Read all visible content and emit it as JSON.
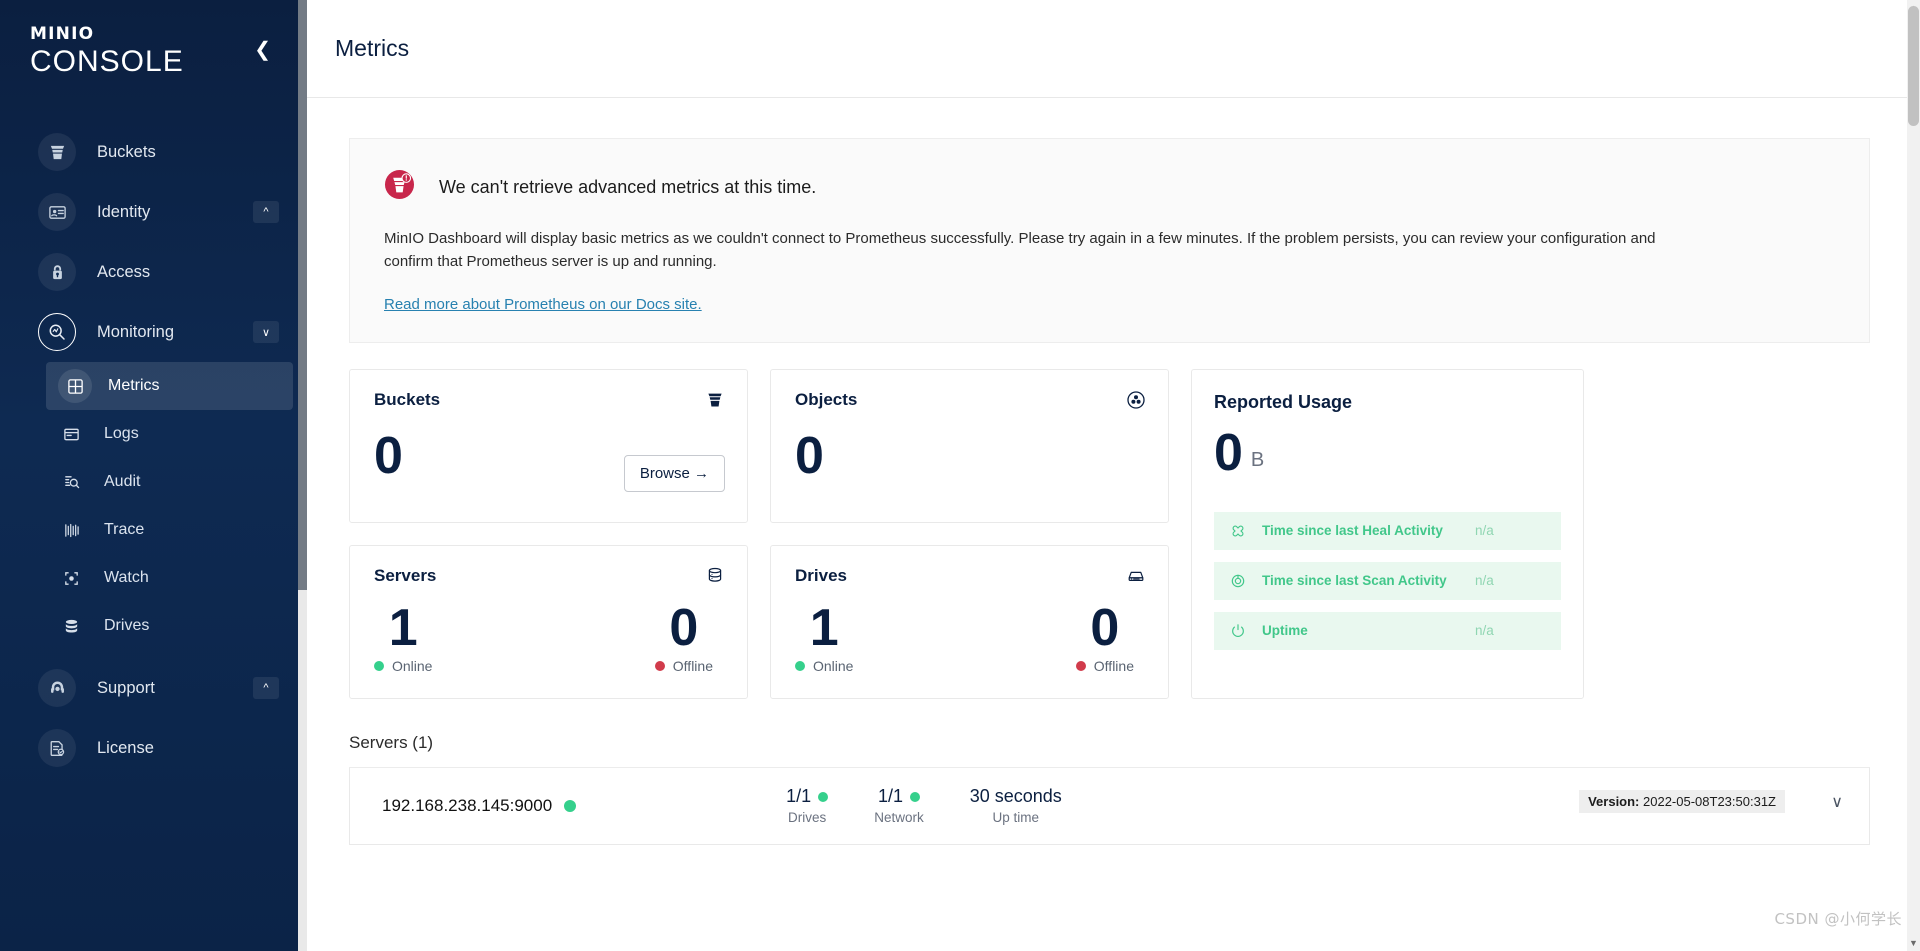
{
  "sidebar": {
    "logo_top": "MINIO",
    "logo_bottom": "CONSOLE",
    "collapse_icon": "chevron-left-icon",
    "items": [
      {
        "label": "Buckets",
        "icon": "bucket-icon",
        "expandable": false
      },
      {
        "label": "Identity",
        "icon": "identity-card-icon",
        "expandable": true,
        "chevron": "^"
      },
      {
        "label": "Access",
        "icon": "lock-icon",
        "expandable": false
      },
      {
        "label": "Monitoring",
        "icon": "monitoring-magnifier-icon",
        "expandable": true,
        "chevron": "∨"
      }
    ],
    "monitoring_children": [
      {
        "label": "Metrics",
        "icon": "grid-icon",
        "active": true
      },
      {
        "label": "Logs",
        "icon": "logs-icon",
        "active": false
      },
      {
        "label": "Audit",
        "icon": "audit-icon",
        "active": false
      },
      {
        "label": "Trace",
        "icon": "trace-icon",
        "active": false
      },
      {
        "label": "Watch",
        "icon": "watch-icon",
        "active": false
      },
      {
        "label": "Drives",
        "icon": "drives-icon",
        "active": false
      }
    ],
    "bottom_items": [
      {
        "label": "Support",
        "icon": "headset-icon",
        "expandable": true,
        "chevron": "^"
      },
      {
        "label": "License",
        "icon": "license-doc-icon",
        "expandable": false
      }
    ]
  },
  "header": {
    "title": "Metrics"
  },
  "alert": {
    "icon": "minio-error-icon",
    "title": "We can't retrieve advanced metrics at this time.",
    "body": "MinIO Dashboard will display basic metrics as we couldn't connect to Prometheus successfully. Please try again in a few minutes. If the problem persists, you can review your configuration and confirm that Prometheus server is up and running.",
    "link": "Read more about Prometheus on our Docs site."
  },
  "cards": {
    "buckets": {
      "title": "Buckets",
      "value": "0",
      "icon": "bucket-icon",
      "button": "Browse →"
    },
    "objects": {
      "title": "Objects",
      "value": "0",
      "icon": "objects-icon"
    },
    "servers": {
      "title": "Servers",
      "icon": "server-stack-icon",
      "online_value": "1",
      "online_label": "Online",
      "offline_value": "0",
      "offline_label": "Offline"
    },
    "drives": {
      "title": "Drives",
      "icon": "drive-icon",
      "online_value": "1",
      "online_label": "Online",
      "offline_value": "0",
      "offline_label": "Offline"
    }
  },
  "usage": {
    "title": "Reported Usage",
    "value": "0",
    "unit": "B",
    "rows": [
      {
        "label": "Time since last Heal Activity",
        "value": "n/a",
        "icon": "heal-icon"
      },
      {
        "label": "Time since last Scan Activity",
        "value": "n/a",
        "icon": "scan-icon"
      },
      {
        "label": "Uptime",
        "value": "n/a",
        "icon": "power-icon"
      }
    ]
  },
  "servers_section": {
    "heading": "Servers (1)",
    "row": {
      "address": "192.168.238.145:9000",
      "status": "online",
      "drives_value": "1/1",
      "drives_label": "Drives",
      "network_value": "1/1",
      "network_label": "Network",
      "uptime_value": "30 seconds",
      "uptime_label": "Up time",
      "version_label": "Version:",
      "version_value": "2022-05-08T23:50:31Z",
      "expand_icon": "chevron-down-icon"
    }
  },
  "watermark": "CSDN @小何学长",
  "colors": {
    "sidebar_bg": "#0b2347",
    "navy": "#0b1f40",
    "green": "#35d08c",
    "red": "#d13b4b",
    "link": "#2781b0",
    "usage_row_bg": "#e9f8ef",
    "usage_row_text": "#41c78a"
  }
}
